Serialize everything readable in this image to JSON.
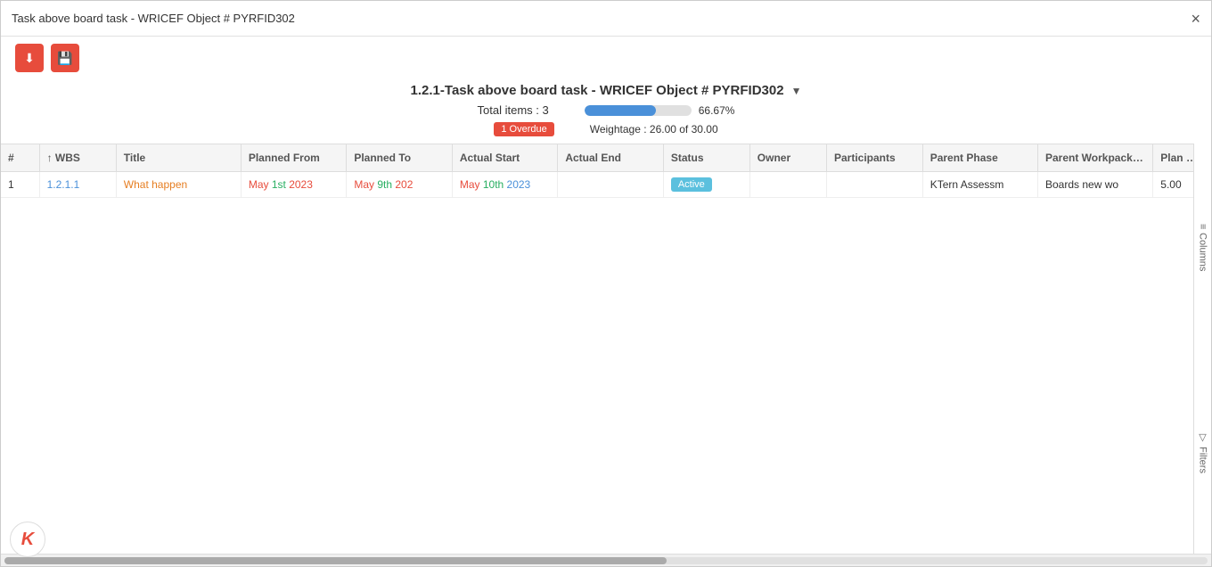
{
  "modal": {
    "title": "Task above board task - WRICEF Object # PYRFID302",
    "close_label": "×"
  },
  "toolbar": {
    "download_icon": "⬇",
    "save_icon": "💾"
  },
  "report": {
    "title": "1.2.1-Task above board task - WRICEF Object # PYRFID302",
    "dropdown_arrow": "▼",
    "total_items_label": "Total items : 3",
    "progress_percent": "66.67%",
    "progress_value": 66.67,
    "overdue_badge": "1 Overdue",
    "weightage_label": "Weightage : 26.00 of 30.00"
  },
  "table": {
    "columns": [
      {
        "key": "num",
        "label": "#"
      },
      {
        "key": "wbs",
        "label": "↑ WBS"
      },
      {
        "key": "title",
        "label": "Title"
      },
      {
        "key": "planned_from",
        "label": "Planned From"
      },
      {
        "key": "planned_to",
        "label": "Planned To"
      },
      {
        "key": "actual_start",
        "label": "Actual Start"
      },
      {
        "key": "actual_end",
        "label": "Actual End"
      },
      {
        "key": "status",
        "label": "Status"
      },
      {
        "key": "owner",
        "label": "Owner"
      },
      {
        "key": "participants",
        "label": "Participants"
      },
      {
        "key": "parent_phase",
        "label": "Parent Phase"
      },
      {
        "key": "parent_wp",
        "label": "Parent Workpackage"
      },
      {
        "key": "plan_weight",
        "label": "Plan Weig"
      }
    ],
    "rows": [
      {
        "num": "1",
        "wbs": "1.2.1.1",
        "title": "What happen",
        "planned_from": "May 1st 2023",
        "planned_to": "May 9th 202",
        "actual_start": "May 10th 2023",
        "actual_end": "",
        "status": "Active",
        "owner": "",
        "participants": "",
        "parent_phase": "KTern Assessm",
        "parent_wp": "Boards new wo",
        "plan_weight": "5.00"
      }
    ]
  },
  "side_panel": {
    "columns_label": "Columns",
    "filters_label": "Filters",
    "columns_icon": "≡",
    "filters_icon": "▽"
  }
}
